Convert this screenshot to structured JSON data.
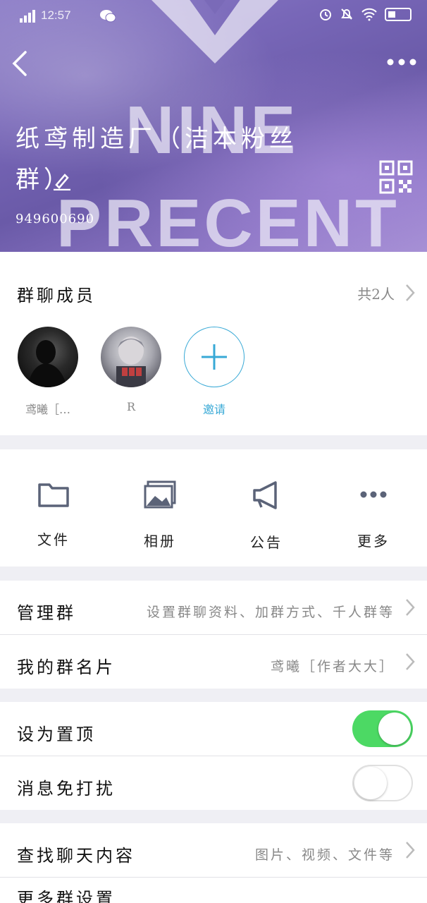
{
  "status_bar": {
    "time": "12:57"
  },
  "header": {
    "group_name": "纸鸢制造厂（洁本粉丝群）",
    "group_id": "949600690",
    "background_text": [
      "NINE",
      "PRECENT"
    ]
  },
  "members": {
    "title": "群聊成员",
    "count": "共2人",
    "list": [
      {
        "name": "鸢曦［…"
      },
      {
        "name": "R"
      }
    ],
    "invite_label": "邀请"
  },
  "tools": [
    {
      "label": "文件",
      "icon": "folder-icon"
    },
    {
      "label": "相册",
      "icon": "photos-icon"
    },
    {
      "label": "公告",
      "icon": "megaphone-icon"
    },
    {
      "label": "更多",
      "icon": "more-icon"
    }
  ],
  "settings": {
    "manage": {
      "label": "管理群",
      "value": "设置群聊资料、加群方式、千人群等"
    },
    "card": {
      "label": "我的群名片",
      "value": "鸢曦［作者大大］"
    },
    "pin": {
      "label": "设为置顶",
      "on": true
    },
    "mute": {
      "label": "消息免打扰",
      "on": false
    },
    "search": {
      "label": "查找聊天内容",
      "value": "图片、视频、文件等"
    },
    "more_partial": {
      "label": "更多群设置"
    }
  },
  "colors": {
    "accent": "#38a9d6",
    "toggle_on": "#4cd964",
    "icon_gray": "#5b6378"
  }
}
